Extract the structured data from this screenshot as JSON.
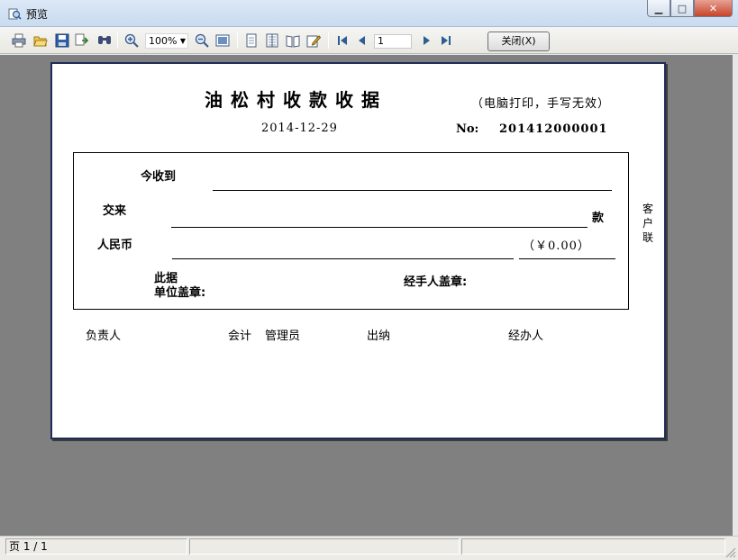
{
  "window": {
    "title": "预览",
    "minimize": "▁",
    "maximize": "□",
    "close": "✕"
  },
  "toolbar": {
    "zoom": "100%",
    "page": "1",
    "close_label": "关闭(X)"
  },
  "receipt": {
    "title": "油松村收款收据",
    "note": "（电脑打印，手写无效）",
    "date": "2014-12-29",
    "no_label": "No:",
    "no_value": "201412000001",
    "received_label": "今收到",
    "from_label": "交来",
    "kuan_label": "款",
    "rmb_label": "人民币",
    "amount": "（￥0.00）",
    "this_receipt_label": "此据",
    "unit_seal_label": "单位盖章:",
    "handler_seal_label": "经手人盖章:",
    "copy_label": "客户联",
    "signers": [
      "负责人",
      "会计",
      "管理员",
      "出纳",
      "经办人"
    ]
  },
  "status": {
    "page_info": "页 1 / 1"
  }
}
